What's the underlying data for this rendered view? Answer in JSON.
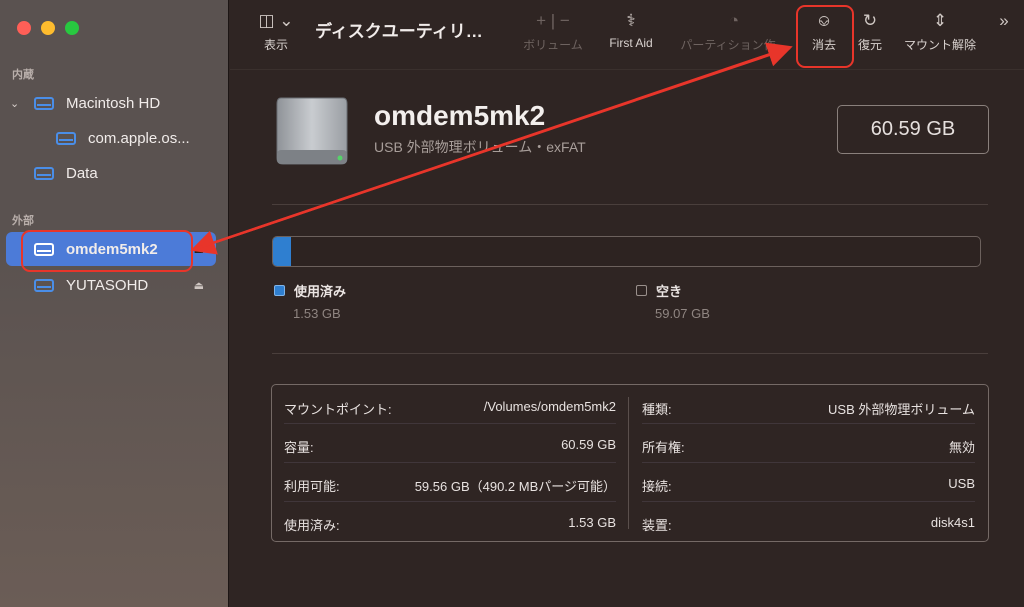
{
  "sidebar": {
    "section_internal": "内蔵",
    "section_external": "外部",
    "items": [
      {
        "label": "Macintosh HD"
      },
      {
        "label": "com.apple.os..."
      },
      {
        "label": "Data"
      },
      {
        "label": "omdem5mk2"
      },
      {
        "label": "YUTASOHD"
      }
    ]
  },
  "toolbar": {
    "view_label": "表示",
    "title": "ディスクユーティリ…",
    "volume_label": "ボリューム",
    "firstaid_label": "First Aid",
    "partition_label": "パーティション作…",
    "erase_label": "消去",
    "restore_label": "復元",
    "unmount_label": "マウント解除"
  },
  "volume": {
    "name": "omdem5mk2",
    "subtitle": "USB 外部物理ボリューム・exFAT",
    "capacity": "60.59 GB",
    "used_fraction": 0.025
  },
  "legend": {
    "used_label": "使用済み",
    "used_value": "1.53 GB",
    "free_label": "空き",
    "free_value": "59.07 GB"
  },
  "info": {
    "left": [
      {
        "k": "マウントポイント:",
        "v": "/Volumes/omdem5mk2"
      },
      {
        "k": "容量:",
        "v": "60.59 GB"
      },
      {
        "k": "利用可能:",
        "v": "59.56 GB（490.2 MBパージ可能）"
      },
      {
        "k": "使用済み:",
        "v": "1.53 GB"
      }
    ],
    "right": [
      {
        "k": "種類:",
        "v": "USB 外部物理ボリューム"
      },
      {
        "k": "所有権:",
        "v": "無効"
      },
      {
        "k": "接続:",
        "v": "USB"
      },
      {
        "k": "装置:",
        "v": "disk4s1"
      }
    ]
  },
  "colors": {
    "accent": "#4c7bd8",
    "annotation": "#e8352a",
    "used_bar": "#2f7fd0"
  }
}
